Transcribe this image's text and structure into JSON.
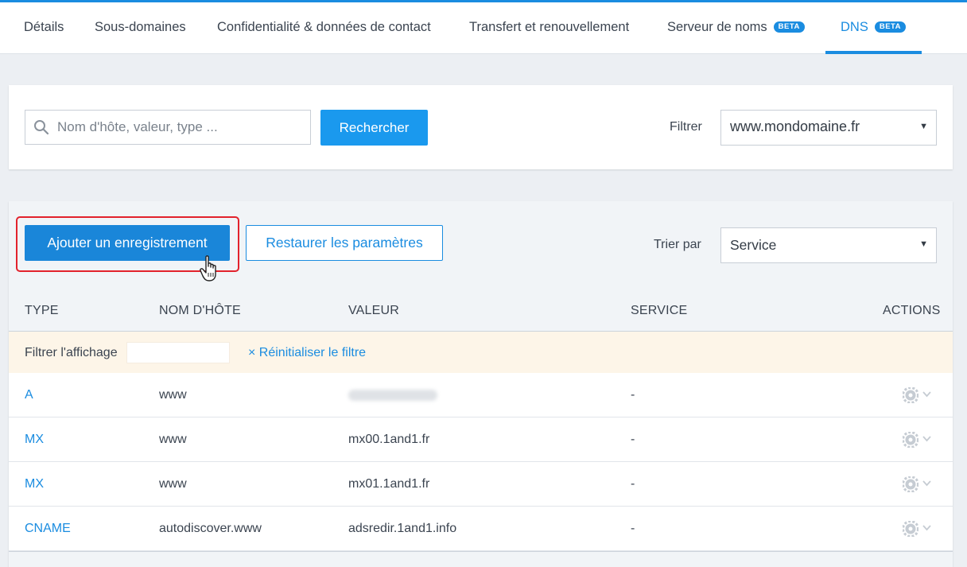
{
  "tabs": [
    {
      "label": "Détails",
      "badge": ""
    },
    {
      "label": "Sous-domaines",
      "badge": ""
    },
    {
      "label": "Confidentialité & données de contact",
      "badge": ""
    },
    {
      "label": "Transfert et renouvellement",
      "badge": ""
    },
    {
      "label": "Serveur de noms",
      "badge": "BETA"
    },
    {
      "label": "DNS",
      "badge": "BETA"
    }
  ],
  "search": {
    "placeholder": "Nom d'hôte, valeur, type ...",
    "button_label": "Rechercher",
    "filter_label": "Filtrer",
    "filter_value": "www.mondomaine.fr"
  },
  "toolbar": {
    "add_label": "Ajouter un enregistrement",
    "restore_label": "Restaurer les paramètres",
    "sort_label": "Trier par",
    "sort_value": "Service"
  },
  "table": {
    "headers": {
      "type": "TYPE",
      "host": "NOM D'HÔTE",
      "value": "VALEUR",
      "service": "SERVICE",
      "actions": "ACTIONS"
    },
    "filter_label": "Filtrer l'affichage",
    "reset_label": "× Réinitialiser le filtre",
    "rows": [
      {
        "type": "A",
        "host": "www",
        "value": "",
        "service": "-"
      },
      {
        "type": "MX",
        "host": "www",
        "value": "mx00.1and1.fr",
        "service": "-"
      },
      {
        "type": "MX",
        "host": "www",
        "value": "mx01.1and1.fr",
        "service": "-"
      },
      {
        "type": "CNAME",
        "host": "autodiscover.www",
        "value": "adsredir.1and1.info",
        "service": "-"
      }
    ]
  },
  "icons": {
    "search": "search-icon",
    "dropdown": "triangle-down-icon",
    "gear": "gear-icon",
    "chevron": "chevron-down-icon",
    "cursor": "hand-pointer-icon"
  },
  "colors": {
    "accent": "#1a8ce0",
    "highlight": "#e2222c",
    "filter_row": "#fdf5e8"
  }
}
